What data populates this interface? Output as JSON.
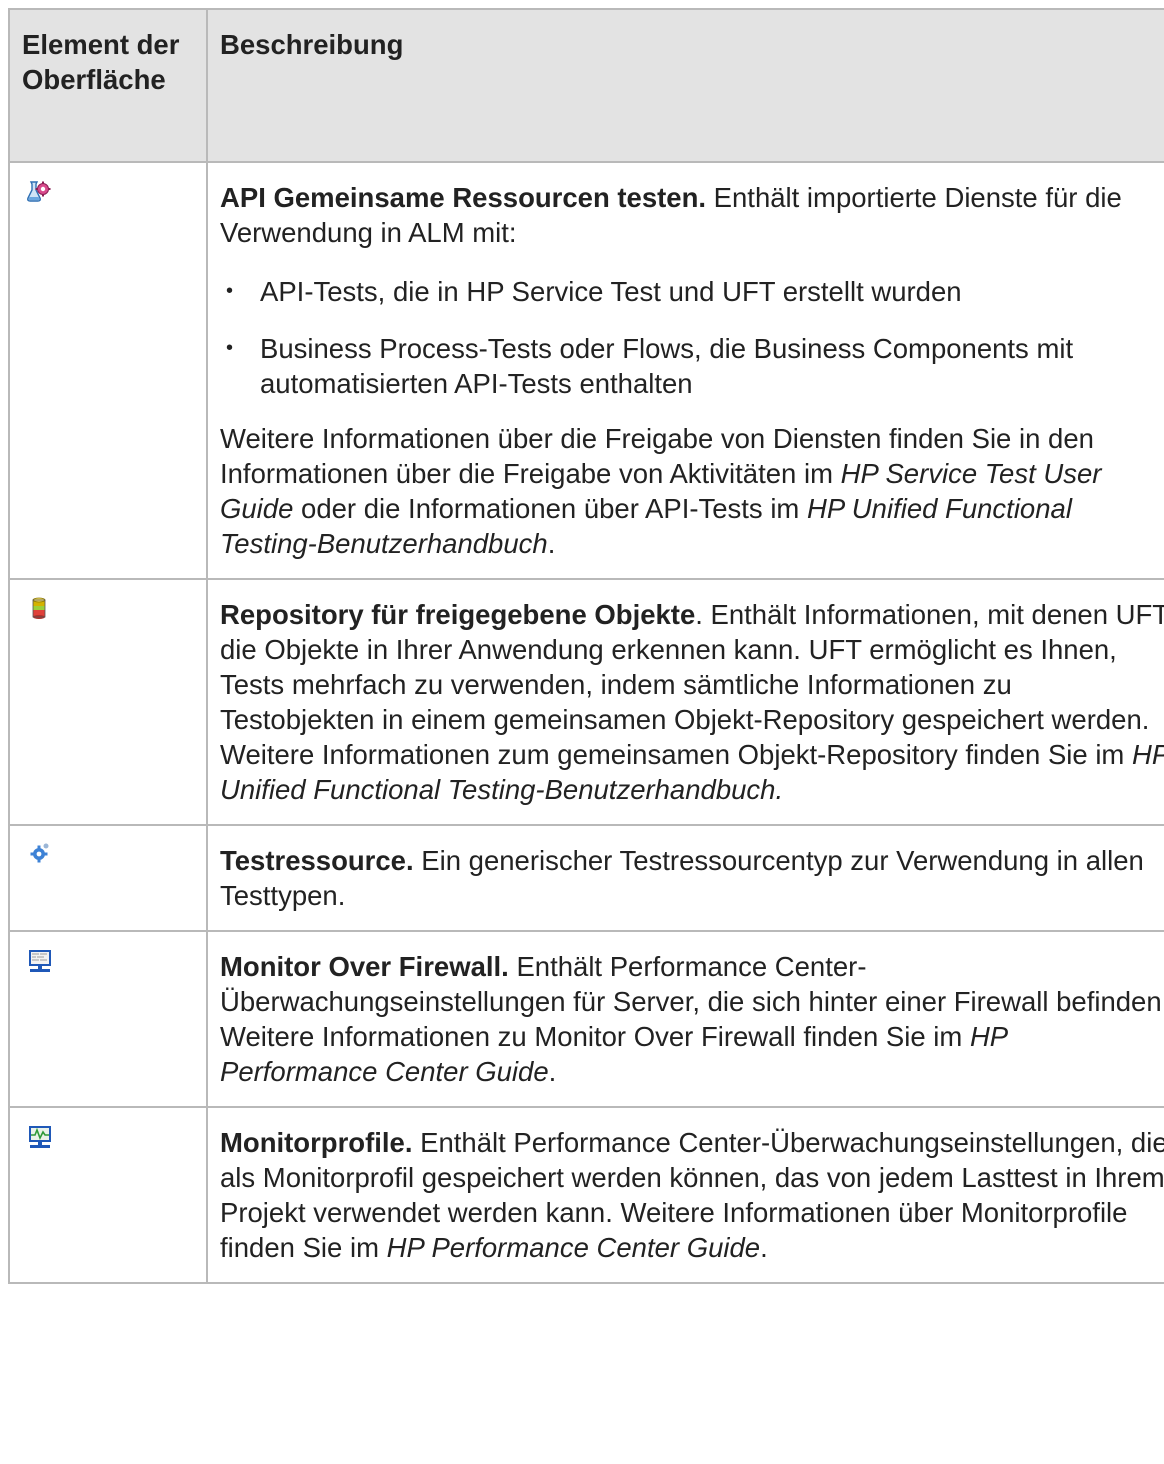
{
  "header": {
    "col1": "Element der Oberfläche",
    "col2": "Beschreibung"
  },
  "rows": [
    {
      "icon": "api-shared-resource-icon",
      "title": "API Gemeinsame Ressourcen testen.",
      "intro": " Enthält importierte Dienste für die Verwendung in ALM mit:",
      "bullets": [
        "API-Tests, die in HP Service Test und UFT erstellt wurden",
        "Business Process-Tests oder Flows, die Business Components mit automatisierten API-Tests enthalten"
      ],
      "p2_a": "Weitere Informationen über die Freigabe von Diensten finden Sie in den Informationen über die Freigabe von Aktivitäten im ",
      "p2_i1": "HP Service Test User Guide",
      "p2_b": " oder die Informationen über API-Tests im ",
      "p2_i2": "HP Unified Functional Testing-Benutzerhandbuch",
      "p2_c": "."
    },
    {
      "icon": "repository-cylinder-icon",
      "title": "Repository für freigegebene Objekte",
      "text": ". Enthält Informationen, mit denen UFT die Objekte in Ihrer Anwendung erkennen kann. UFT ermöglicht es Ihnen, Tests mehrfach zu verwenden, indem sämtliche Informationen zu Testobjekten in einem gemeinsamen Objekt-Repository gespeichert werden. Weitere Informationen zum gemeinsamen Objekt-Repository finden Sie im ",
      "italic": "HP Unified Functional Testing-Benutzerhandbuch."
    },
    {
      "icon": "test-resource-gear-icon",
      "title": "Testressource.",
      "text": " Ein generischer Testressourcentyp zur Verwendung in allen Testtypen."
    },
    {
      "icon": "monitor-over-firewall-icon",
      "title": "Monitor Over Firewall.",
      "text": " Enthält Performance Center-Überwachungseinstellungen für Server, die sich hinter einer Firewall befinden. Weitere Informationen zu Monitor Over Firewall finden Sie im ",
      "italic": "HP Performance Center Guide",
      "end": "."
    },
    {
      "icon": "monitor-profile-icon",
      "title": "Monitorprofile.",
      "text": " Enthält Performance Center-Überwachungseinstellungen, die als Monitorprofil gespeichert werden können, das von jedem Lasttest in Ihrem Projekt verwendet werden kann. Weitere Informationen über Monitorprofile finden Sie im ",
      "italic": "HP Performance Center Guide",
      "end": "."
    }
  ],
  "bullet_glyph": "•",
  "colors": {
    "header_bg": "#e3e3e3",
    "border": "#b9b9b9",
    "text": "#222222"
  }
}
